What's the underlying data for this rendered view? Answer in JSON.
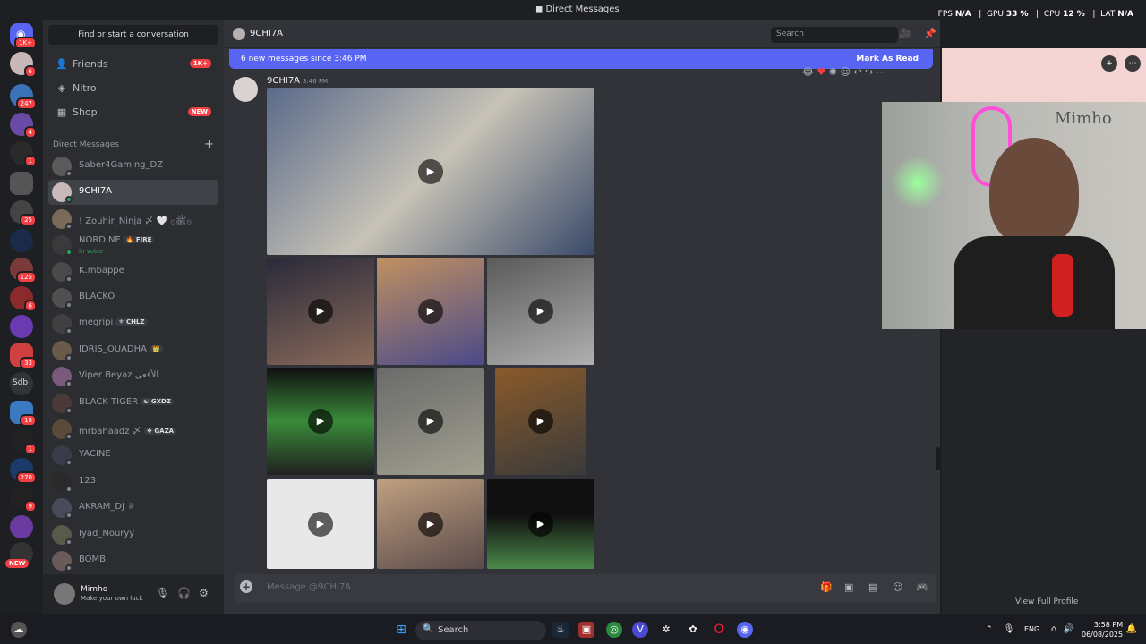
{
  "window": {
    "title": "Direct Messages"
  },
  "overlay": {
    "fps_label": "FPS",
    "fps_value": "N/A",
    "gpu_label": "GPU",
    "gpu_value": "33 %",
    "cpu_label": "CPU",
    "cpu_value": "12 %",
    "lat_label": "LAT",
    "lat_value": "N/A"
  },
  "rail": {
    "badges": [
      "1K+",
      "6",
      "247",
      "4",
      "1",
      "25",
      "125",
      "6",
      "33",
      "18",
      "1",
      "270",
      "9"
    ],
    "text_server": "Sdb",
    "new_label": "NEW"
  },
  "sidebar": {
    "find_label": "Find or start a conversation",
    "nav": [
      {
        "label": "Friends",
        "badge": "1K+",
        "icon": "friends-icon"
      },
      {
        "label": "Nitro",
        "badge": "",
        "icon": "nitro-icon"
      },
      {
        "label": "Shop",
        "badge": "NEW",
        "icon": "shop-icon"
      }
    ],
    "dm_header": "Direct Messages",
    "dms": [
      {
        "name": "Saber4Gaming_DZ",
        "tag": "",
        "sub": "",
        "status": "offline"
      },
      {
        "name": "9CHI7A",
        "tag": "",
        "sub": "",
        "status": "online"
      },
      {
        "name": "! Zouhir_Ninja 〆 🤍 ۞ﷺ۞",
        "tag": "",
        "sub": "",
        "status": "offline"
      },
      {
        "name": "NORDINE",
        "tag": "🔥 FIRE",
        "sub": "In voice",
        "status": "online"
      },
      {
        "name": "K.mbappe",
        "tag": "",
        "sub": "",
        "status": "offline"
      },
      {
        "name": "BLACKO",
        "tag": "",
        "sub": "",
        "status": "offline"
      },
      {
        "name": "megripi",
        "tag": "⚜ CHLZ",
        "sub": "",
        "status": "offline"
      },
      {
        "name": "IDRIS_OUADHA",
        "tag": "👑",
        "sub": "",
        "status": "offline"
      },
      {
        "name": "Viper Beyaz الأفعى",
        "tag": "",
        "sub": "",
        "status": "offline"
      },
      {
        "name": "BLACK TIGER",
        "tag": "☯ GXDZ",
        "sub": "",
        "status": "offline"
      },
      {
        "name": "mrbahaadz 〆",
        "tag": "❖ GAZA",
        "sub": "",
        "status": "offline"
      },
      {
        "name": "YACINE",
        "tag": "",
        "sub": "",
        "status": "offline"
      },
      {
        "name": "123",
        "tag": "",
        "sub": "",
        "status": "offline"
      },
      {
        "name": "AKRAM_DJ ♕",
        "tag": "",
        "sub": "",
        "status": "offline"
      },
      {
        "name": "Iyad_Nouryy",
        "tag": "",
        "sub": "",
        "status": "offline"
      },
      {
        "name": "BOMB",
        "tag": "",
        "sub": "",
        "status": "offline"
      }
    ]
  },
  "user": {
    "name": "Mimho",
    "status": "Make your own luck"
  },
  "chat": {
    "channel": "9CHI7A",
    "search_placeholder": "Search",
    "new_messages": "6 new messages since 3:46 PM",
    "mark_read": "Mark As Read",
    "author": "9CHI7A",
    "time": "3:46 PM",
    "composer_placeholder": "Message @9CHI7A",
    "video_count": 10
  },
  "profile": {
    "view_full": "View Full Profile",
    "webcam_label": "Mimho"
  },
  "taskbar": {
    "search": "Search",
    "lang": "ENG",
    "time": "3:58 PM",
    "date": "06/08/2025"
  },
  "colors": {
    "accent": "#5865f2",
    "badge": "#f23f43",
    "online": "#23a55a"
  }
}
